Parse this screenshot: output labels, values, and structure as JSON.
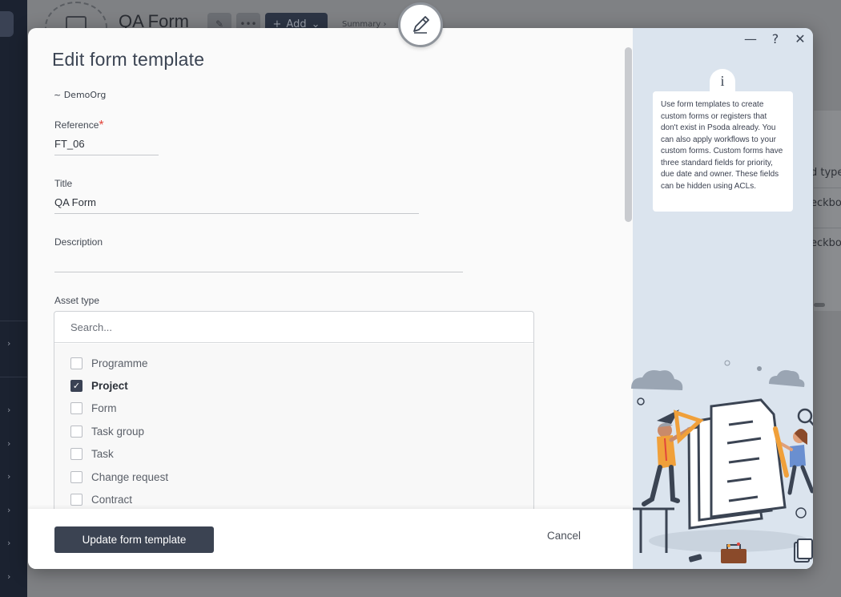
{
  "background": {
    "app_title": "QA Form",
    "add_label": "Add",
    "summary_label": "Summary ›",
    "card_header": "d type",
    "card_rows": [
      "eckbo",
      "eckbo"
    ]
  },
  "modal": {
    "title": "Edit form template",
    "org": "~ DemoOrg",
    "reference": {
      "label": "Reference",
      "required_mark": "*",
      "value": "FT_06"
    },
    "title_field": {
      "label": "Title",
      "value": "QA Form"
    },
    "description": {
      "label": "Description",
      "value": ""
    },
    "asset_type": {
      "label": "Asset type",
      "search_placeholder": "Search...",
      "items": [
        {
          "label": "Programme",
          "checked": false
        },
        {
          "label": "Project",
          "checked": true
        },
        {
          "label": "Form",
          "checked": false
        },
        {
          "label": "Task group",
          "checked": false
        },
        {
          "label": "Task",
          "checked": false
        },
        {
          "label": "Change request",
          "checked": false
        },
        {
          "label": "Contract",
          "checked": false
        }
      ]
    },
    "footer": {
      "primary_label": "Update form template",
      "cancel_label": "Cancel"
    }
  },
  "side_panel": {
    "minimize": "—",
    "help": "?",
    "close": "✕",
    "info_icon": "i",
    "info_text": "Use form templates to create custom forms or registers that don't exist in Psoda already. You can also apply workflows to your custom forms. Custom forms have three standard fields for priority, due date and owner. These fields can be hidden using ACLs."
  },
  "colors": {
    "primary": "#3b4352",
    "panel": "#dbe4ee",
    "required": "#e2453c",
    "accent_orange": "#f0a03a"
  }
}
